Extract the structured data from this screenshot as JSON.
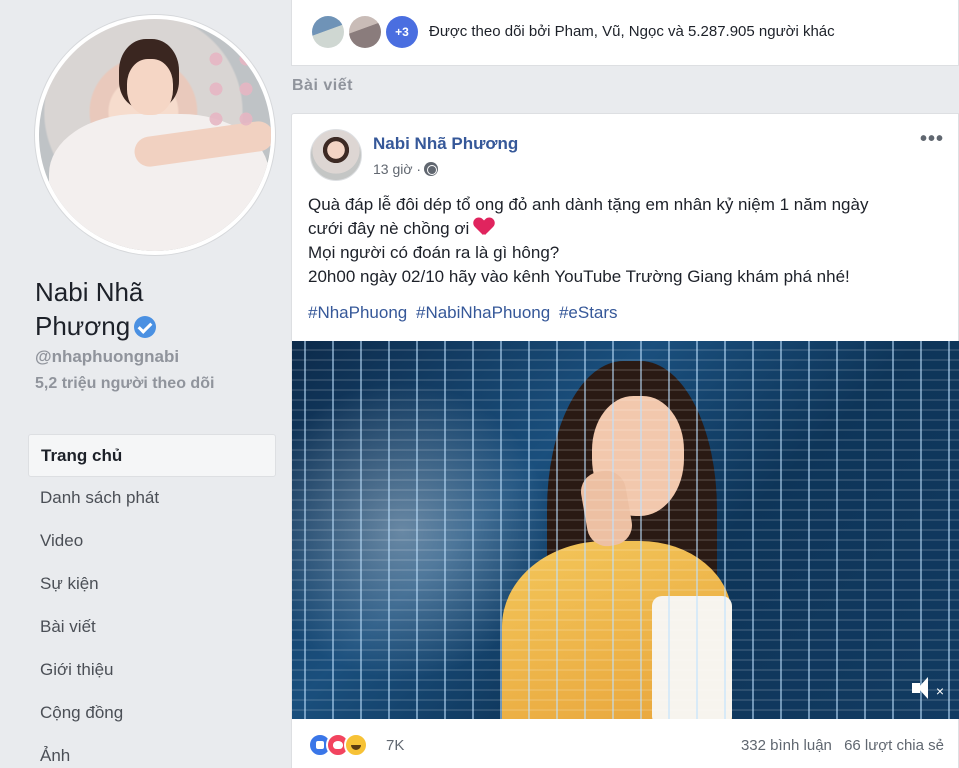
{
  "sidebar": {
    "page_name_line1": "Nabi Nhã",
    "page_name_line2": "Phương",
    "username": "@nhaphuongnabi",
    "followers": "5,2 triệu người theo dõi",
    "items": [
      {
        "label": "Trang chủ",
        "active": true
      },
      {
        "label": "Danh sách phát"
      },
      {
        "label": "Video"
      },
      {
        "label": "Sự kiện"
      },
      {
        "label": "Bài viết"
      },
      {
        "label": "Giới thiệu"
      },
      {
        "label": "Cộng đồng"
      },
      {
        "label": "Ảnh"
      }
    ]
  },
  "followed_by": {
    "extra_badge": "+3",
    "text": "Được theo dõi bởi Pham, Vũ, Ngọc và 5.287.905 người khác"
  },
  "section_label": "Bài viết",
  "post": {
    "author": "Nabi Nhã Phương",
    "time": "13 giờ ·",
    "text_line1": "Quà đáp lễ đôi dép tổ ong đỏ anh dành tặng em nhân kỷ niệm 1 năm ngày",
    "text_line2": "cưới đây nè chồng ơi",
    "text_line3": "Mọi người có đoán ra là gì hông?",
    "text_line4": "20h00 ngày 02/10 hãy vào kênh YouTube Trường Giang khám phá nhé!",
    "hashtags": [
      "#NhaPhuong",
      "#NabiNhaPhuong",
      "#eStars"
    ],
    "more_label": "•••",
    "reaction_count": "7K",
    "comments": "332 bình luận",
    "shares": "66 lượt chia sẻ"
  },
  "colors": {
    "link": "#365899",
    "verified": "#4a90e2",
    "background": "#e9ebee"
  }
}
